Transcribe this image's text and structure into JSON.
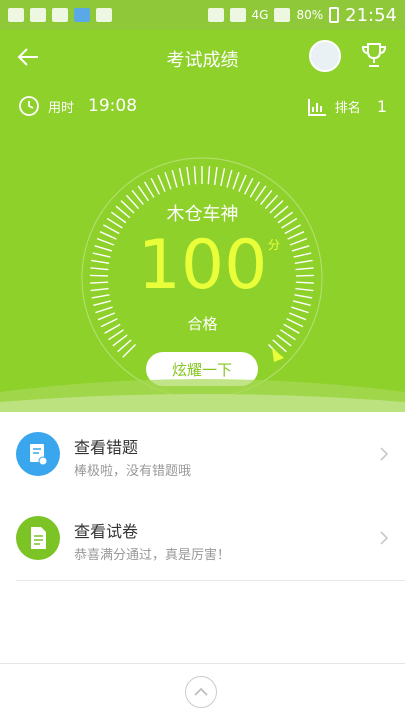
{
  "status": {
    "battery": "80%",
    "network": "4G",
    "time": "21:54"
  },
  "header": {
    "title": "考试成绩"
  },
  "stats": {
    "time_label": "用时",
    "time_value": "19:08",
    "rank_label": "排名",
    "rank_value": "1"
  },
  "result": {
    "name": "木仓车神",
    "score": "100",
    "unit": "分",
    "grade": "合格",
    "score_fraction": 1.0
  },
  "share_button": "炫耀一下",
  "list": [
    {
      "title": "查看错题",
      "subtitle": "棒极啦，没有错题哦",
      "icon": "wrong-answers-icon",
      "color": "#3aa6ee"
    },
    {
      "title": "查看试卷",
      "subtitle": "恭喜满分通过，真是厉害！",
      "icon": "exam-paper-icon",
      "color": "#7cc425"
    }
  ],
  "colors": {
    "accent": "#8fd12b",
    "score": "#e8ff3a"
  }
}
